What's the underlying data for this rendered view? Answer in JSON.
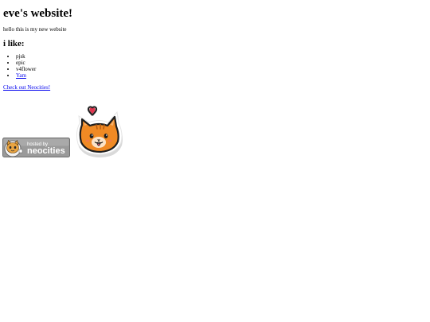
{
  "page": {
    "title": "eve's website!",
    "intro": "hello this is my new website",
    "likes_heading": "i like:",
    "likes": [
      "pjsk",
      "epic",
      "v4flower",
      "Yam"
    ],
    "link_text": "Check out Neocities!",
    "badge_small": "hosted by",
    "badge_big": "neocities"
  },
  "colors": {
    "link": "#0000ee",
    "cat_orange": "#f08a24",
    "badge_bg": "#9a9a9a",
    "heart": "#e0334d"
  }
}
